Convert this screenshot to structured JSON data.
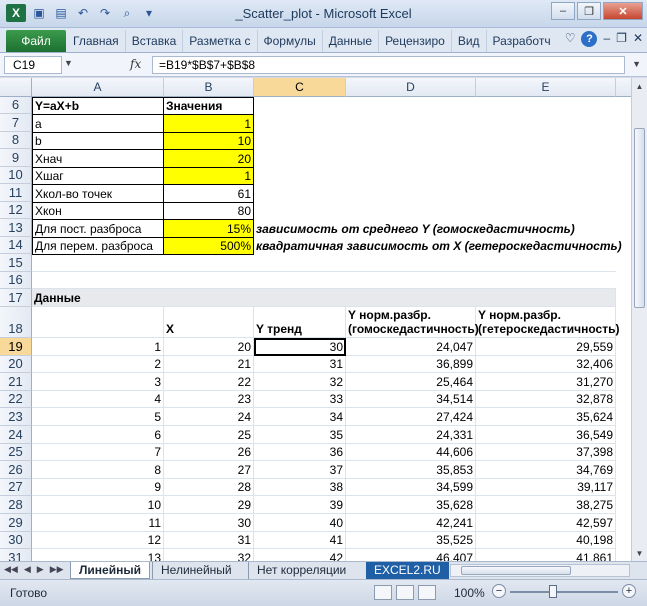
{
  "window": {
    "title": "_Scatter_plot - Microsoft Excel"
  },
  "ribbon": {
    "file_tab": "Файл",
    "tabs": [
      "Главная",
      "Вставка",
      "Разметка с",
      "Формулы",
      "Данные",
      "Рецензиро",
      "Вид",
      "Разработч"
    ]
  },
  "formula_bar": {
    "name_box": "C19",
    "fx": "fx",
    "formula": "=B19*$B$7+$B$8"
  },
  "columns": [
    "A",
    "B",
    "C",
    "D",
    "E"
  ],
  "rows": {
    "r6": {
      "num": "6",
      "a": "Y=aX+b",
      "b": "Значения"
    },
    "r7": {
      "num": "7",
      "a": "a",
      "b": "1"
    },
    "r8": {
      "num": "8",
      "a": "b",
      "b": "10"
    },
    "r9": {
      "num": "9",
      "a": "Xнач",
      "b": "20"
    },
    "r10": {
      "num": "10",
      "a": "Xшаг",
      "b": "1"
    },
    "r11": {
      "num": "11",
      "a": "Xкол-во точек",
      "b": "61"
    },
    "r12": {
      "num": "12",
      "a": "Xкон",
      "b": "80"
    },
    "r13": {
      "num": "13",
      "a": "Для пост. разброса",
      "b": "15%",
      "c": "зависимость от среднего Y (гомоскедастичность)"
    },
    "r14": {
      "num": "14",
      "a": "Для перем. разброса",
      "b": "500%",
      "c": "квадратичная зависимость от X (гетероскедастичность)"
    },
    "r15": {
      "num": "15"
    },
    "r16": {
      "num": "16"
    },
    "r17": {
      "num": "17",
      "a": "Данные"
    },
    "r18": {
      "num": "18",
      "b": "X",
      "c": "Y тренд",
      "d1": "Y норм.разбр.",
      "d2": "(гомоскедастичность)",
      "e1": "Y норм.разбр.",
      "e2": "(гетероскедастичность)"
    }
  },
  "data_rows": [
    {
      "num": "19",
      "a": "1",
      "b": "20",
      "c": "30",
      "d": "24,047",
      "e": "29,559"
    },
    {
      "num": "20",
      "a": "2",
      "b": "21",
      "c": "31",
      "d": "36,899",
      "e": "32,406"
    },
    {
      "num": "21",
      "a": "3",
      "b": "22",
      "c": "32",
      "d": "25,464",
      "e": "31,270"
    },
    {
      "num": "22",
      "a": "4",
      "b": "23",
      "c": "33",
      "d": "34,514",
      "e": "32,878"
    },
    {
      "num": "23",
      "a": "5",
      "b": "24",
      "c": "34",
      "d": "27,424",
      "e": "35,624"
    },
    {
      "num": "24",
      "a": "6",
      "b": "25",
      "c": "35",
      "d": "24,331",
      "e": "36,549"
    },
    {
      "num": "25",
      "a": "7",
      "b": "26",
      "c": "36",
      "d": "44,606",
      "e": "37,398"
    },
    {
      "num": "26",
      "a": "8",
      "b": "27",
      "c": "37",
      "d": "35,853",
      "e": "34,769"
    },
    {
      "num": "27",
      "a": "9",
      "b": "28",
      "c": "38",
      "d": "34,599",
      "e": "39,117"
    },
    {
      "num": "28",
      "a": "10",
      "b": "29",
      "c": "39",
      "d": "35,628",
      "e": "38,275"
    },
    {
      "num": "29",
      "a": "11",
      "b": "30",
      "c": "40",
      "d": "42,241",
      "e": "42,597"
    },
    {
      "num": "30",
      "a": "12",
      "b": "31",
      "c": "41",
      "d": "35,525",
      "e": "40,198"
    },
    {
      "num": "31",
      "a": "13",
      "b": "32",
      "c": "42",
      "d": "46,407",
      "e": "41,861"
    }
  ],
  "sheets": [
    "Линейный",
    "Нелинейный",
    "Нет корреляции",
    "EXCEL2.RU"
  ],
  "status": {
    "ready": "Готово",
    "zoom": "100%"
  }
}
